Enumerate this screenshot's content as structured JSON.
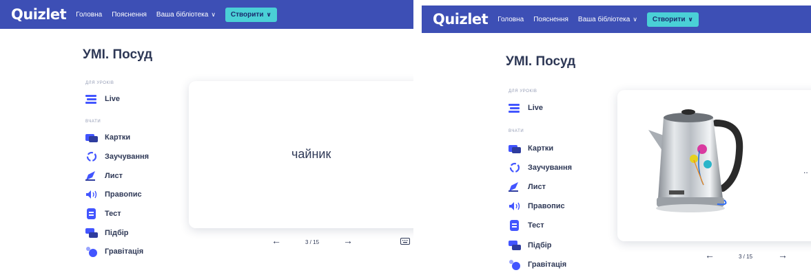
{
  "app": {
    "logo": "Quizlet",
    "nav": {
      "home": "Головна",
      "explanations": "Пояснення",
      "library": "Ваша бібліотека",
      "create": "Створити"
    },
    "colors": {
      "navbar": "#3d4fb5",
      "create_button": "#4ad0d6",
      "icon_blue": "#4255ff"
    }
  },
  "set": {
    "title": "УМІ. Посуд",
    "sections": {
      "lessons": "ДЛЯ УРОКІВ",
      "study": "ВЧАТИ"
    },
    "modes": {
      "live": "Live",
      "flashcards": "Картки",
      "learn": "Заучування",
      "write": "Лист",
      "spell": "Правопис",
      "test": "Тест",
      "match": "Підбір",
      "gravity": "Гравітація"
    }
  },
  "left_view": {
    "card_side": "term",
    "card_text": "чайник",
    "counter": "3 / 15"
  },
  "right_view": {
    "card_side": "image",
    "image_alt": "electric kettle VITESSE",
    "counter": "3 / 15",
    "overflow_text": ".."
  },
  "icons": [
    "arrow-left-icon",
    "arrow-right-icon",
    "keyboard-icon",
    "live-icon",
    "cards-icon",
    "learn-icon",
    "write-icon",
    "spell-icon",
    "test-icon",
    "match-icon",
    "gravity-icon"
  ]
}
